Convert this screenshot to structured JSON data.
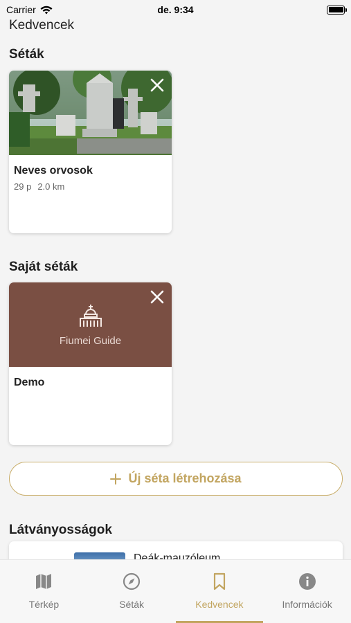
{
  "status": {
    "carrier": "Carrier",
    "time": "de. 9:34"
  },
  "page": {
    "title": "Kedvencek"
  },
  "sections": {
    "walks": "Séták",
    "own_walks": "Saját séták",
    "sights": "Látványosságok"
  },
  "walk_card": {
    "title": "Neves orvosok",
    "duration": "29 p",
    "distance": "2.0 km"
  },
  "own_walk_card": {
    "title": "Demo",
    "logo_text": "Fiumei Guide"
  },
  "new_walk": {
    "icon": "plus-icon",
    "label": "Új séta létrehozása"
  },
  "sight_card": {
    "title": "Deák-mauzóleum"
  },
  "tabs": [
    {
      "label": "Térkép",
      "icon": "map-icon"
    },
    {
      "label": "Séták",
      "icon": "compass-icon"
    },
    {
      "label": "Kedvencek",
      "icon": "bookmark-icon",
      "active": true
    },
    {
      "label": "Információk",
      "icon": "info-icon"
    }
  ],
  "colors": {
    "accent": "#c2a560",
    "guide_brown": "#7a4f43",
    "background": "#f4f4f4"
  }
}
